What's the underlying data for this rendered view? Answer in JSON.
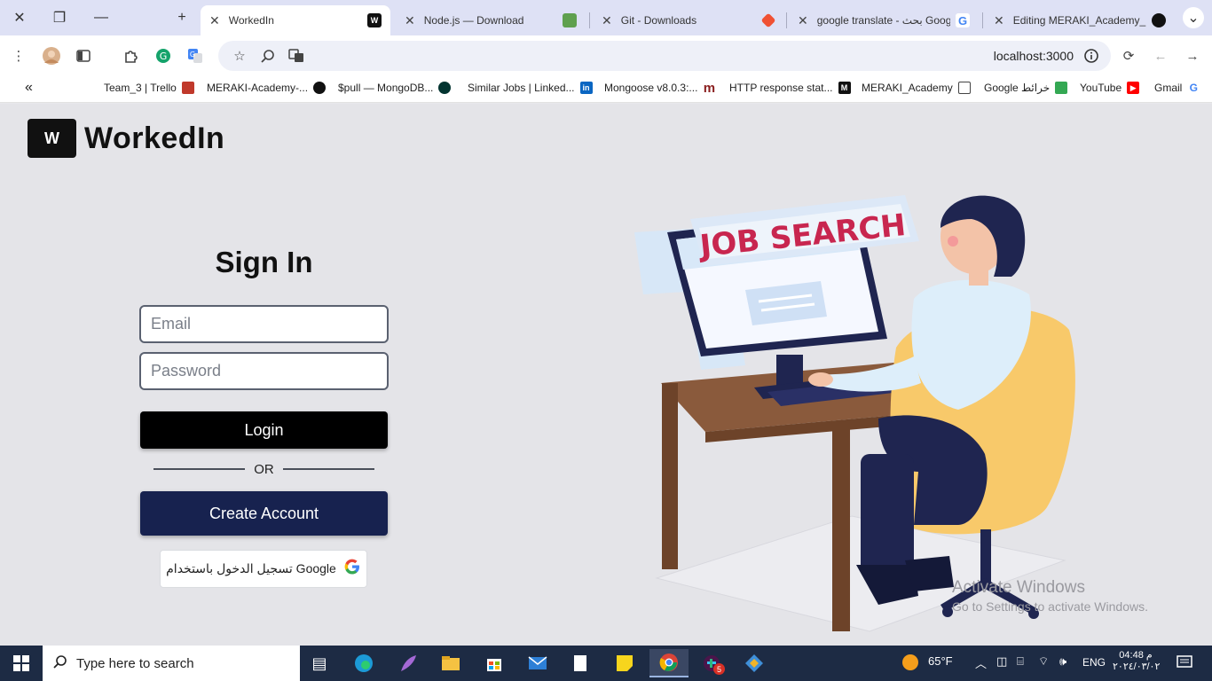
{
  "browser": {
    "tabs": [
      {
        "title": "WorkedIn",
        "active": true
      },
      {
        "title": "Node.js — Download"
      },
      {
        "title": "Git - Downloads"
      },
      {
        "title": "google translate - بحث Goog"
      },
      {
        "title": "Editing MERAKI_Academy_P"
      }
    ],
    "url": "localhost:3000",
    "bookmarks": [
      "Team_3 | Trello",
      "MERAKI-Academy-...",
      "$pull — MongoDB...",
      "Similar Jobs | Linked...",
      "Mongoose v8.0.3:...",
      "HTTP response stat...",
      "MERAKI_Academy",
      "Google خرائط",
      "YouTube",
      "Gmail"
    ]
  },
  "app": {
    "logo_mark": "W",
    "brand": "WorkedIn"
  },
  "signin": {
    "title": "Sign In",
    "email_placeholder": "Email",
    "password_placeholder": "Password",
    "login_label": "Login",
    "or_label": "OR",
    "create_label": "Create Account",
    "google_label": "تسجيل الدخول باستخدام Google"
  },
  "illustration": {
    "banner_text": "JOB SEARCH"
  },
  "watermark": {
    "line1": "Activate Windows",
    "line2": "Go to Settings to activate Windows."
  },
  "taskbar": {
    "search_placeholder": "Type here to search",
    "weather": "65°F",
    "language": "ENG",
    "time": "04:48 م",
    "date": "٢٠٢٤/٠٣/٠٢",
    "notification_count": "5"
  },
  "colors": {
    "primary_navy": "#17224f",
    "login_black": "#000000",
    "page_bg": "#e4e4e8"
  }
}
